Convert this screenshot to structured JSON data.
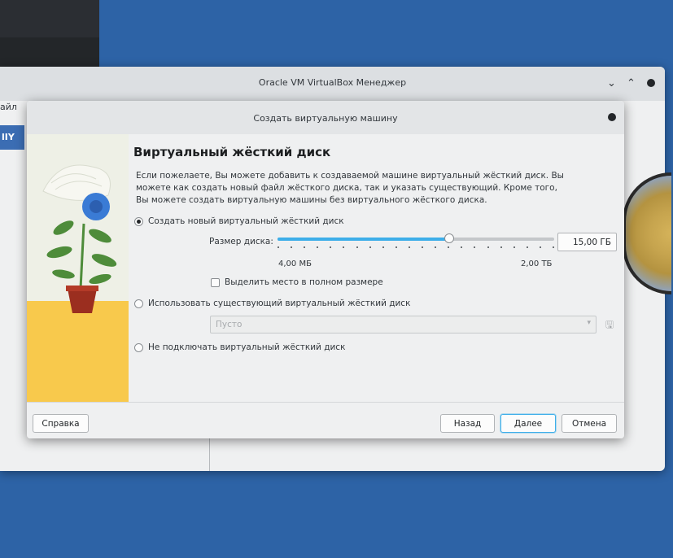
{
  "manager": {
    "title": "Oracle VM VirtualBox Менеджер",
    "menu_fragment": "айл",
    "tool_fragment": "lIY"
  },
  "dialog": {
    "title": "Создать виртуальную машину",
    "heading": "Виртуальный жёсткий диск",
    "description": "Если пожелаете, Вы можете добавить к создаваемой машине виртуальный жёсткий диск. Вы можете как создать новый файл жёсткого диска, так и указать существующий. Кроме того, Вы можете создать виртуальную машины без виртуального жёсткого диска.",
    "options": {
      "create_new": "Создать новый виртуальный жёсткий диск",
      "use_existing": "Использовать существующий виртуальный жёсткий диск",
      "no_disk": "Не подключать виртуальный жёсткий диск",
      "selected": "create_new"
    },
    "disk_size": {
      "label": "Размер диска:",
      "value": "15,00 ГБ",
      "min_label": "4,00 МБ",
      "max_label": "2,00 ТБ",
      "slider_fraction": 0.62
    },
    "preallocate": {
      "label": "Выделить место в полном размере",
      "checked": false
    },
    "existing_disk_combo": {
      "value": "Пусто"
    },
    "buttons": {
      "help": "Справка",
      "back": "Назад",
      "next": "Далее",
      "cancel": "Отмена"
    }
  },
  "colors": {
    "desktop": "#2d63a6",
    "accent": "#3daee9",
    "art_floor": "#f8c94c",
    "flower": "#3a7bd5",
    "leaves": "#4e8c3a",
    "pot": "#9b2e1f"
  }
}
